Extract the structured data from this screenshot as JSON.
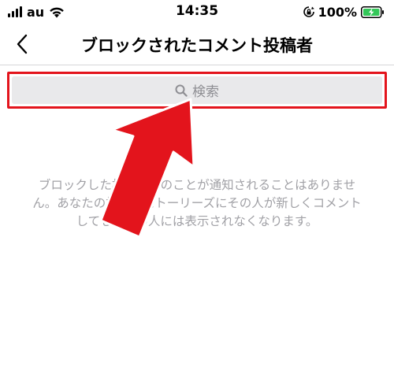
{
  "status_bar": {
    "carrier": "au",
    "time": "14:35",
    "battery": "100%",
    "icons": [
      "signal-icon",
      "wifi-icon",
      "rotation-lock-icon",
      "battery-charging-icon"
    ]
  },
  "nav": {
    "back_icon": "chevron-left-icon",
    "title": "ブロックされたコメント投稿者"
  },
  "search": {
    "icon": "search-icon",
    "placeholder": "検索"
  },
  "description": "ブロックした相手にそのことが通知されることはありません。あなたの投稿やストーリーズにその人が新しくコメントしても、他の人には表示されなくなります。",
  "annotation": {
    "highlight_color": "#e3141c",
    "arrow_color": "#e3141c",
    "battery_color": "#34c759"
  }
}
